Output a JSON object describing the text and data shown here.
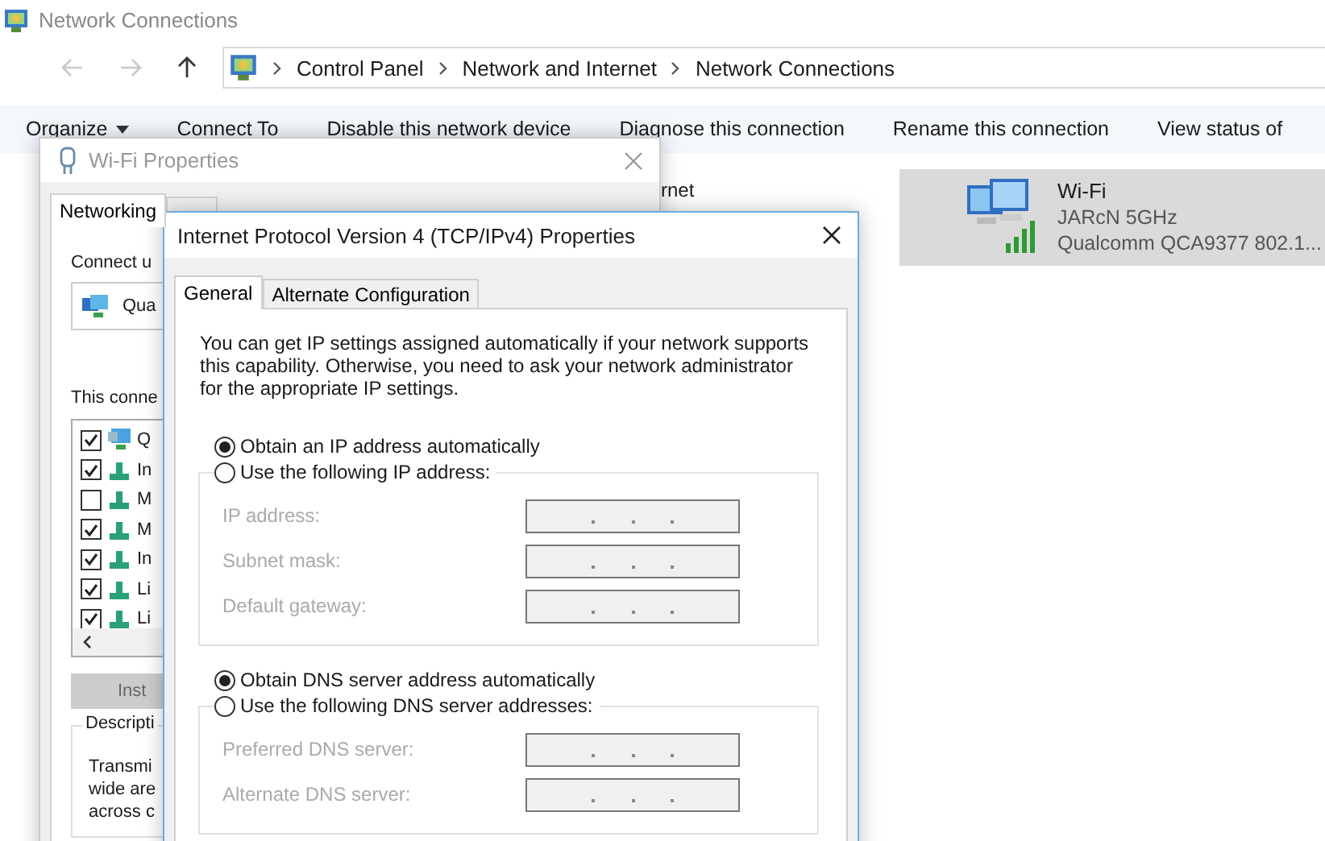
{
  "explorer": {
    "title": "Network Connections",
    "breadcrumb": [
      "Control Panel",
      "Network and Internet",
      "Network Connections"
    ],
    "toolbar": [
      {
        "label": "Organize",
        "dropdown": true
      },
      {
        "label": "Connect To",
        "dropdown": false
      },
      {
        "label": "Disable this network device",
        "dropdown": false
      },
      {
        "label": "Diagnose this connection",
        "dropdown": false
      },
      {
        "label": "Rename this connection",
        "dropdown": false
      },
      {
        "label": "View status of",
        "dropdown": false
      }
    ],
    "partial_item_text": "rnet",
    "connection": {
      "name": "Wi-Fi",
      "network": "JARcN 5GHz",
      "adapter": "Qualcomm QCA9377 802.1...",
      "selected": true
    }
  },
  "wifi_dialog": {
    "title": "Wi-Fi Properties",
    "tabs": [
      {
        "label": "Networking",
        "selected": true
      },
      {
        "selected": false
      }
    ],
    "connect_label": "Connect u",
    "adapter_field": "Qua",
    "list_label": "This conne",
    "components": [
      {
        "label": "Q",
        "checked": true,
        "kind": "client"
      },
      {
        "label": "In",
        "checked": true,
        "kind": "protocol"
      },
      {
        "label": "M",
        "checked": false,
        "kind": "protocol"
      },
      {
        "label": "M",
        "checked": true,
        "kind": "protocol"
      },
      {
        "label": "In",
        "checked": true,
        "kind": "protocol"
      },
      {
        "label": "Li",
        "checked": true,
        "kind": "protocol"
      },
      {
        "label": "Li",
        "checked": true,
        "kind": "protocol"
      }
    ],
    "install_button": "Inst",
    "description_label": "Descripti",
    "description_lines": [
      "Transmi",
      "wide are",
      "across c"
    ]
  },
  "ipv4_dialog": {
    "title": "Internet Protocol Version 4 (TCP/IPv4) Properties",
    "tabs": [
      {
        "label": "General",
        "selected": true
      },
      {
        "label": "Alternate Configuration",
        "selected": false
      }
    ],
    "intro": "You can get IP settings assigned automatically if your network supports this capability. Otherwise, you need to ask your network administrator for the appropriate IP settings.",
    "ip_auto": {
      "label": "Obtain an IP address automatically",
      "selected": true
    },
    "ip_manual": {
      "label": "Use the following IP address:",
      "selected": false
    },
    "ip_fields": [
      {
        "label": "IP address:",
        "disabled": true
      },
      {
        "label": "Subnet mask:",
        "disabled": true
      },
      {
        "label": "Default gateway:",
        "disabled": true
      }
    ],
    "dns_auto": {
      "label": "Obtain DNS server address automatically",
      "selected": true
    },
    "dns_manual": {
      "label": "Use the following DNS server addresses:",
      "selected": false
    },
    "dns_fields": [
      {
        "label": "Preferred DNS server:",
        "disabled": true
      },
      {
        "label": "Alternate DNS server:",
        "disabled": true
      }
    ]
  }
}
